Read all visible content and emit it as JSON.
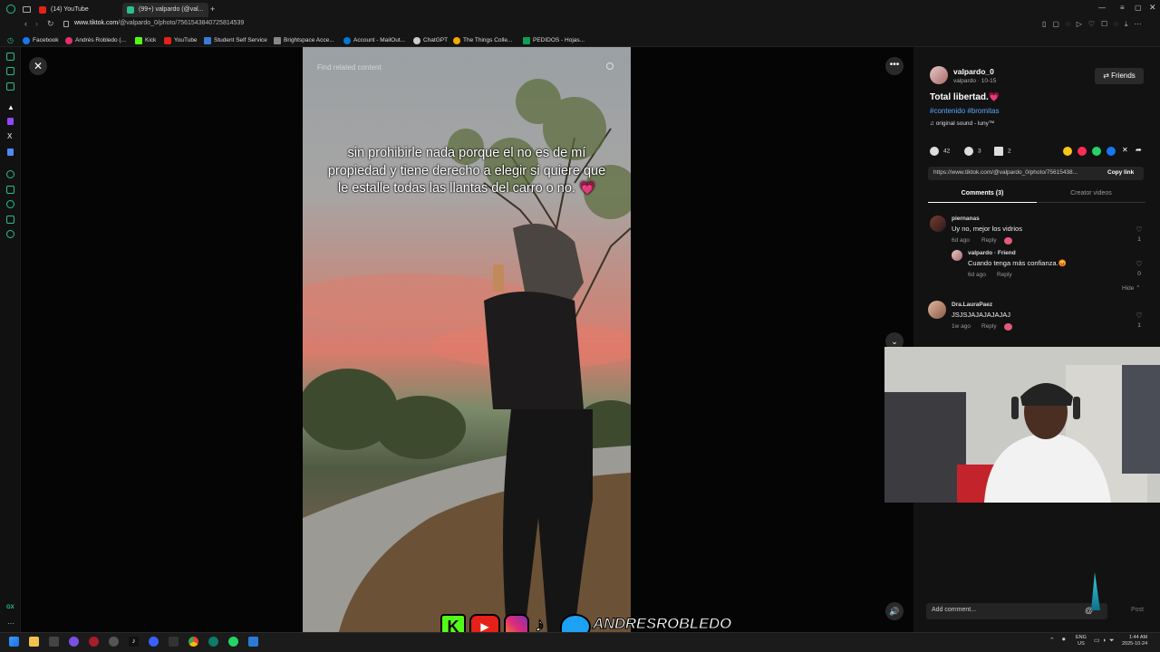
{
  "browser": {
    "tabs": [
      {
        "label": "(14) YouTube",
        "color": "#e62117"
      },
      {
        "label": "(99+) valpardo (@val...",
        "color": "#29c089"
      }
    ],
    "url_host": "www.tiktok.com",
    "url_path": "/@valpardo_0/photo/7561543840725814539",
    "bookmarks": [
      {
        "label": "Facebook",
        "color": "#1877f2"
      },
      {
        "label": "Andrés Robledo (...",
        "color": "#e1306c"
      },
      {
        "label": "Kick",
        "color": "#53fc18"
      },
      {
        "label": "YouTube",
        "color": "#e62117"
      },
      {
        "label": "Student Self Service",
        "color": "#3a7bd5"
      },
      {
        "label": "Brightspace Acce...",
        "color": "#888888"
      },
      {
        "label": "Account - MailOut...",
        "color": "#0078d4"
      },
      {
        "label": "ChatGPT",
        "color": "#cccccc"
      },
      {
        "label": "The Things Colle...",
        "color": "#f2a900"
      },
      {
        "label": "PEDIDOS - Hojas...",
        "color": "#0f9d58"
      }
    ]
  },
  "player": {
    "search_placeholder": "Find related content",
    "caption": "sin prohibirle nada porque el no es de mí propiedad y tiene derecho a elegir si quiere que le estalle todas las llantas del carro o no. 💗"
  },
  "post": {
    "author_name": "valpardo_0",
    "author_sub": "valpardo · 10-15",
    "friends_label": "Friends",
    "title": "Total libertad.💗",
    "tags": "#contenido #bromitas",
    "sound": "original sound - luny™",
    "likes": "42",
    "comments_count": "3",
    "saves": "2",
    "link": "https://www.tiktok.com/@valpardo_0/photo/75615438...",
    "copy_label": "Copy link",
    "tab_comments": "Comments (3)",
    "tab_creator": "Creator videos",
    "hide_label": "Hide ⌃",
    "add_comment": "Add comment...",
    "post_label": "Post",
    "comments": [
      {
        "user": "piernanas",
        "text": "Uy no, mejor los vidrios",
        "meta": "6d ago",
        "reply": "Reply",
        "likes": "1"
      },
      {
        "user": "valpardo · Friend",
        "text": "Cuando tenga más confianza.😡",
        "meta": "6d ago",
        "reply": "Reply",
        "likes": "0"
      },
      {
        "user": "Dra.LauraPaez",
        "text": "JSJSJAJAJAJAJAJ",
        "meta": "1w ago",
        "reply": "Reply",
        "likes": "1"
      }
    ]
  },
  "overlay": {
    "social_name": "ANDRESROBLEDO"
  },
  "taskbar": {
    "lang_top": "ENG",
    "lang_bottom": "US",
    "time": "1:44 AM",
    "date": "2025-10-24"
  }
}
